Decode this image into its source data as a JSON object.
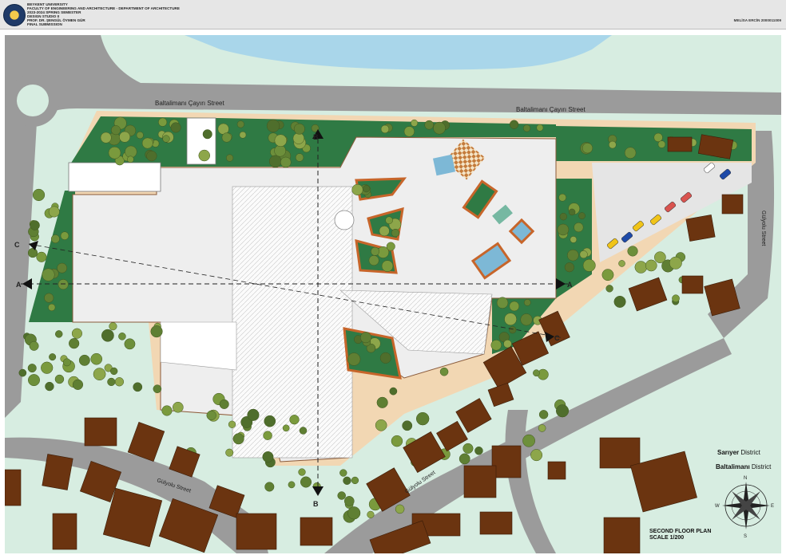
{
  "header": {
    "lines": [
      "BEYKENT UNIVERSITY",
      "FACULTY OF ENGINEERING AND ARCHITECTURE - DEPARTMENT OF ARCHITECTURE",
      "2023-2024 SPRING SEMESTER",
      "DESIGN STUDIO II",
      "PROF. DR. ŞENGÜL ÖYMEN GÜR",
      "FINAL SUBMISSION"
    ],
    "student": "MELİSA ERCİN 2000011009"
  },
  "streets": {
    "main_left": "Baltalimanı Çayırı Street",
    "main_right": "Baltalimanı Çayırı Street",
    "side_right": "Gülyolu Street",
    "bottom_left": "Gülyolu Street",
    "bottom_mid": "Gülyolu Street"
  },
  "sections": {
    "a": "A",
    "b": "B",
    "c": "C"
  },
  "districts": {
    "sariyer_name": "Sarıyer",
    "baltalimani_name": "Baltalimanı",
    "word": "District"
  },
  "plan": {
    "title": "SECOND FLOOR PLAN",
    "scale": "SCALE 1/200"
  },
  "compass": {
    "n": "N",
    "s": "S",
    "e": "E",
    "w": "W"
  },
  "colors": {
    "road": "#9b9b9b",
    "lawn": "#d7ede1",
    "garden": "#2f7a44",
    "tree": "#6d8f3b",
    "building": "#6b3410",
    "water": "#a9d6ea",
    "plaza": "#eeeeee",
    "border": "#f2d7b3"
  }
}
